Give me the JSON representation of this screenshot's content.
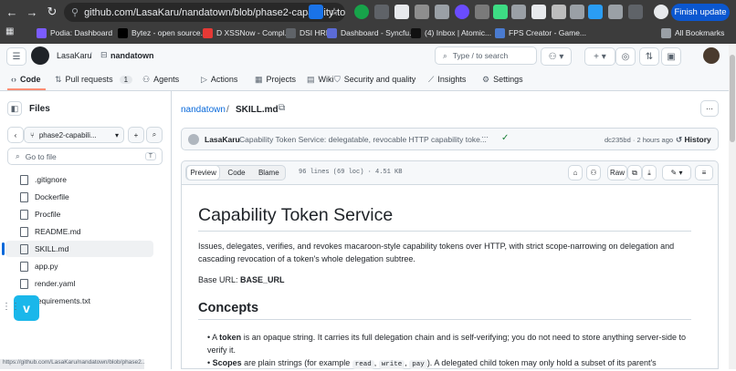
{
  "browser": {
    "url": "github.com/LasaKaru/nandatown/blob/phase2-capability-token...",
    "finish_update": "Finish update",
    "bookmarks": [
      {
        "label": "Podia: Dashboard",
        "color": "#7b5cff"
      },
      {
        "label": "Bytez - open source...",
        "color": "#000000"
      },
      {
        "label": "D XSSNow - Compl...",
        "color": "#e53935"
      },
      {
        "label": "DSI HRIS",
        "color": "#5f6368"
      },
      {
        "label": "Dashboard - Syncfu...",
        "color": "#5b6bd5"
      },
      {
        "label": "(4) Inbox | Atomic...",
        "color": "#111111"
      },
      {
        "label": "FPS Creator - Game...",
        "color": "#4a7bd0"
      }
    ],
    "all_bookmarks": "All Bookmarks"
  },
  "repo": {
    "owner": "LasaKaru",
    "name": "nandatown",
    "search_placeholder": "Type / to search",
    "search_key": "/"
  },
  "tabs": [
    {
      "label": "Code",
      "icon": "code-icon"
    },
    {
      "label": "Pull requests",
      "count": "1",
      "icon": "pull-request-icon"
    },
    {
      "label": "Agents",
      "icon": "agents-icon"
    },
    {
      "label": "Actions",
      "icon": "actions-icon"
    },
    {
      "label": "Projects",
      "icon": "projects-icon"
    },
    {
      "label": "Wiki",
      "icon": "wiki-icon"
    },
    {
      "label": "Security and quality",
      "icon": "shield-icon"
    },
    {
      "label": "Insights",
      "icon": "insights-icon"
    },
    {
      "label": "Settings",
      "icon": "gear-icon"
    }
  ],
  "sidebar": {
    "title": "Files",
    "branch": "phase2-capabili...",
    "goto_placeholder": "Go to file",
    "goto_key": "T",
    "files": [
      ".gitignore",
      "Dockerfile",
      "Procfile",
      "README.md",
      "SKILL.md",
      "app.py",
      "render.yaml",
      "requirements.txt"
    ],
    "selected": "SKILL.md"
  },
  "file": {
    "repo_link": "nandatown",
    "sep": "/",
    "name": "SKILL.md",
    "author": "LasaKaru",
    "commit_msg": "Capability Token Service: delegatable, revocable HTTP capability toke...",
    "commit_hash": "dc235bd",
    "commit_time": "2 hours ago",
    "history": "History"
  },
  "viewer": {
    "preview": "Preview",
    "code": "Code",
    "blame": "Blame",
    "stats": "96 lines (69 loc) · 4.51 KB",
    "raw": "Raw"
  },
  "doc": {
    "h1": "Capability Token Service",
    "intro": "Issues, delegates, verifies, and revokes macaroon-style capability tokens over HTTP, with strict scope-narrowing on delegation and cascading revocation of a token's whole delegation subtree.",
    "base_label": "Base URL: ",
    "base_value": "BASE_URL",
    "h2": "Concepts",
    "b1_pre": "A ",
    "b1_bold": "token",
    "b1_post": " is an opaque string. It carries its full delegation chain and is self-verifying; you do not need to store anything server-side to verify it.",
    "b2_bold": "Scopes",
    "b2_pre": " are plain strings (for example ",
    "b2_c1": "read",
    "b2_c2": "write",
    "b2_c3": "pay",
    "b2_post": "). A delegated child token may only hold a subset of its parent's"
  },
  "status_url": "https://github.com/LasaKaru/nandatown/blob/phase2..."
}
